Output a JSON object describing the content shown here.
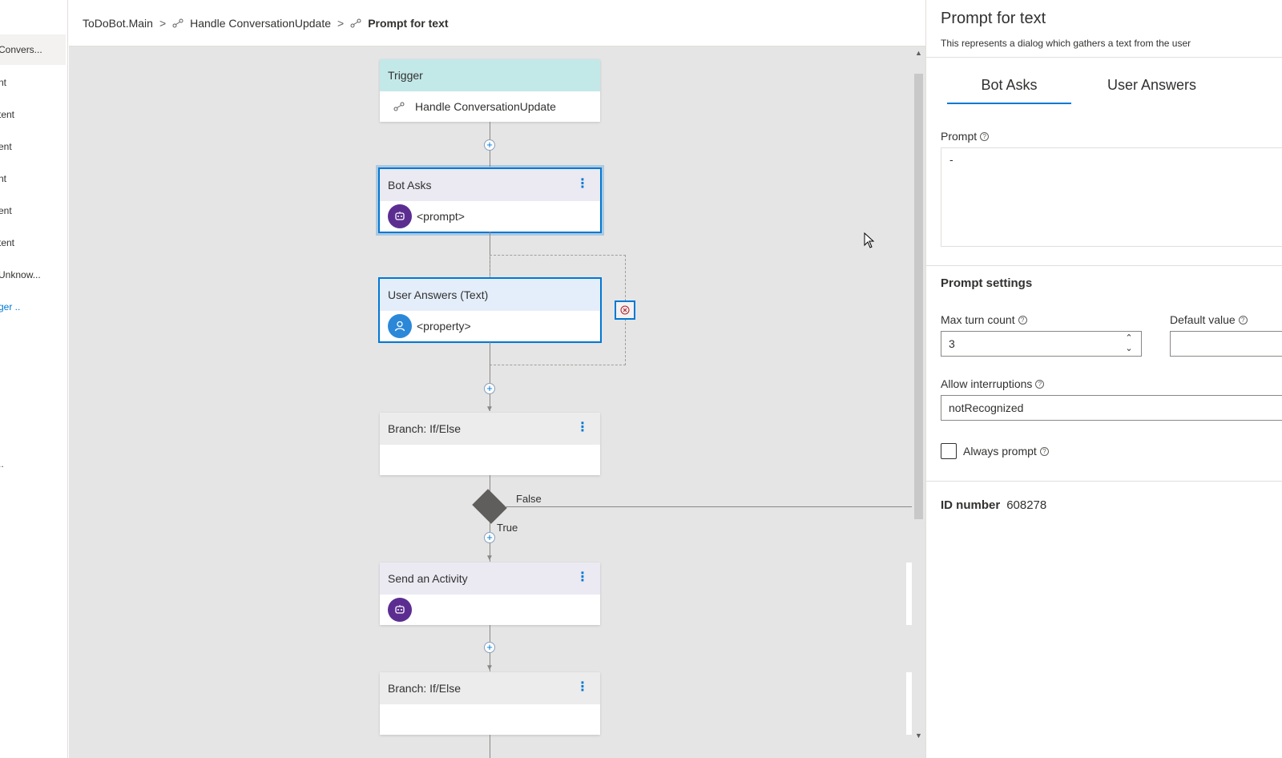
{
  "left_nav": {
    "items": [
      "Convers...",
      "nt",
      "tent",
      "ent",
      "nt",
      "ent",
      "tent",
      "Unknow...",
      "ger ..",
      ".."
    ]
  },
  "breadcrumb": {
    "items": [
      "ToDoBot.Main",
      "Handle ConversationUpdate",
      "Prompt for text"
    ],
    "separator": ">"
  },
  "canvas": {
    "trigger": {
      "header": "Trigger",
      "body": "Handle ConversationUpdate"
    },
    "bot_asks": {
      "header": "Bot Asks",
      "body": "<prompt>",
      "more": "⋮"
    },
    "user_answers": {
      "header": "User Answers (Text)",
      "body": "<property>"
    },
    "branch1": {
      "header": "Branch: If/Else",
      "more": "⋮"
    },
    "branch_false_label": "False",
    "branch_true_label": "True",
    "send_activity": {
      "header": "Send an Activity",
      "more": "⋮"
    },
    "branch2": {
      "header": "Branch: If/Else",
      "more": "⋮"
    }
  },
  "panel": {
    "title": "Prompt for text",
    "subtitle": "This represents a dialog which gathers a text from the user",
    "tabs": [
      "Bot Asks",
      "User Answers"
    ],
    "active_tab": "Bot Asks",
    "prompt_label": "Prompt",
    "prompt_value": "-",
    "settings_header": "Prompt settings",
    "max_turn_label": "Max turn count",
    "max_turn_value": "3",
    "default_value_label": "Default value",
    "default_value": "",
    "allow_interruptions_label": "Allow interruptions",
    "allow_interruptions_value": "notRecognized",
    "always_prompt_label": "Always prompt",
    "always_prompt_checked": false,
    "id_label": "ID number",
    "id_value": "608278"
  },
  "colors": {
    "accent": "#0078d4",
    "trigger_header": "#c3e8e8",
    "bot_header": "#ebe9f2",
    "user_header": "#e4eefa",
    "branch_header": "#ececec",
    "canvas_bg": "#e5e5e5"
  },
  "icons": {
    "dialog_icon": "flow-icon",
    "bot_icon": "bot-icon",
    "user_icon": "person-icon",
    "error_icon": "error-circle-icon",
    "add_icon": "plus-circle-icon"
  }
}
